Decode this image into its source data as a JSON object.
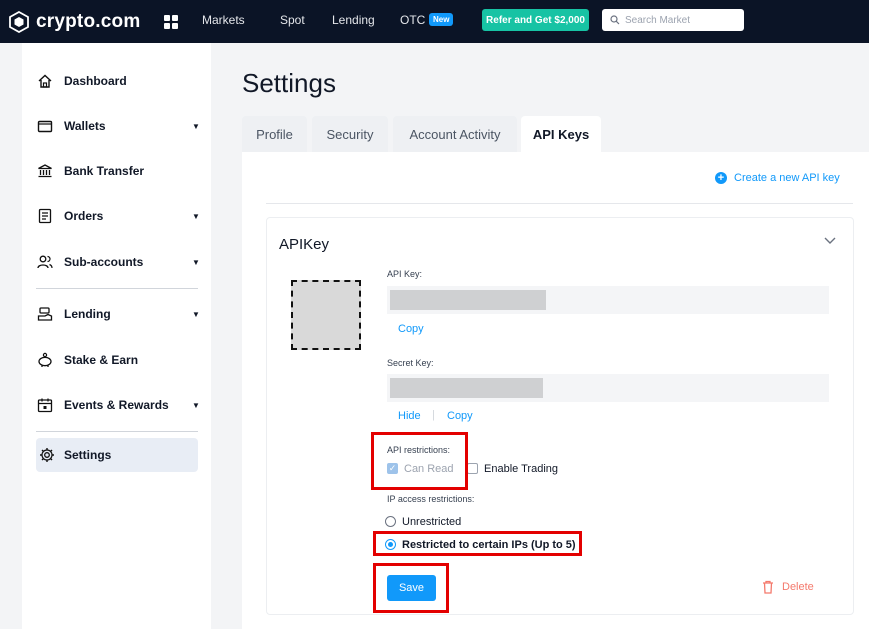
{
  "brand": {
    "name": "crypto.com"
  },
  "topnav": {
    "links": [
      "Markets",
      "Spot",
      "Lending",
      "OTC"
    ],
    "otc_badge": "New",
    "refer_button": "Refer and Get $2,000",
    "search_placeholder": "Search Market"
  },
  "sidebar": {
    "items": [
      {
        "label": "Dashboard",
        "icon": "home-icon",
        "has_caret": false
      },
      {
        "label": "Wallets",
        "icon": "wallet-icon",
        "has_caret": true
      },
      {
        "label": "Bank Transfer",
        "icon": "bank-icon",
        "has_caret": false
      },
      {
        "label": "Orders",
        "icon": "orders-icon",
        "has_caret": true
      },
      {
        "label": "Sub-accounts",
        "icon": "users-icon",
        "has_caret": true
      },
      {
        "label": "Lending",
        "icon": "lending-icon",
        "has_caret": true
      },
      {
        "label": "Stake & Earn",
        "icon": "piggy-bank-icon",
        "has_caret": false
      },
      {
        "label": "Events & Rewards",
        "icon": "calendar-icon",
        "has_caret": true
      },
      {
        "label": "Settings",
        "icon": "gear-icon",
        "has_caret": false,
        "active": true
      }
    ]
  },
  "page": {
    "title": "Settings"
  },
  "tabs": [
    {
      "label": "Profile",
      "active": false
    },
    {
      "label": "Security",
      "active": false
    },
    {
      "label": "Account Activity",
      "active": false
    },
    {
      "label": "API Keys",
      "active": true
    }
  ],
  "api": {
    "create_link": "Create a new API key",
    "card_title": "APIKey",
    "api_key_label": "API Key:",
    "copy_label": "Copy",
    "secret_key_label": "Secret Key:",
    "hide_label": "Hide",
    "secret_copy_label": "Copy",
    "restrictions_label": "API restrictions:",
    "can_read_label": "Can Read",
    "can_read_checked": true,
    "enable_trading_label": "Enable Trading",
    "enable_trading_checked": false,
    "ip_label": "IP access restrictions:",
    "ip_options": [
      {
        "label": "Unrestricted",
        "selected": false
      },
      {
        "label": "Restricted to certain IPs (Up to 5)",
        "selected": true
      }
    ],
    "save_label": "Save",
    "delete_label": "Delete"
  },
  "colors": {
    "topbar": "#0b1426",
    "accent": "#1199fa",
    "refer": "#17c3a4",
    "highlight": "#e30000",
    "delete": "#f4796c"
  }
}
